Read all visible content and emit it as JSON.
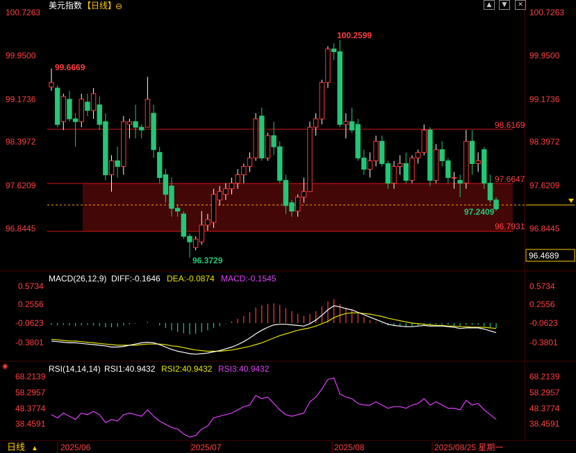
{
  "header": {
    "title": "美元指数",
    "period": "【日线】",
    "gear_icon": "⊖"
  },
  "colors": {
    "up": "#ff3b3b",
    "down": "#22c777",
    "diff": "#ffffff",
    "dea": "#e6e600",
    "macd": "#e040fb",
    "rsi": "#e040fb",
    "axis_text": "#ff4040",
    "grid": "#3a0000"
  },
  "price_axis": {
    "ticks": [
      "100.7263",
      "99.9500",
      "99.1736",
      "98.3972",
      "97.6209",
      "96.8445"
    ],
    "current": "96.4689"
  },
  "annotations": {
    "high": "100.2599",
    "start": "99.6669",
    "low": "96.3729",
    "last": "97.2409",
    "line_upper": "98.6169",
    "line_mid": "97.6647",
    "line_lower": "96.7931"
  },
  "macd": {
    "label": "MACD(26,12,9)",
    "diff_label": "DIFF:-0.1646",
    "dea_label": "DEA:-0.0874",
    "macd_label": "MACD:-0.1545",
    "ticks": [
      "0.5734",
      "0.2556",
      "-0.0623",
      "-0.3801"
    ]
  },
  "rsi": {
    "label": "RSI(14,14,14)",
    "rsi1_label": "RSI1:40.9432",
    "rsi2_label": "RSI2:40.9432",
    "rsi3_label": "RSI3:40.9432",
    "ticks": [
      "68.2139",
      "58.2957",
      "48.3774",
      "38.4591"
    ]
  },
  "footer": {
    "period_label": "日线",
    "dates": [
      "2025/06",
      "2025/07",
      "2025/08"
    ],
    "current_date": "2025/08/25 星期一"
  },
  "chart_data": {
    "type": "candlestick",
    "ylim": [
      96.1,
      100.8
    ],
    "candles": [
      {
        "o": 99.42,
        "h": 99.75,
        "l": 99.35,
        "c": 99.5
      },
      {
        "o": 99.4,
        "h": 99.45,
        "l": 98.7,
        "c": 98.75
      },
      {
        "o": 98.8,
        "h": 99.3,
        "l": 98.65,
        "c": 99.25
      },
      {
        "o": 99.2,
        "h": 99.35,
        "l": 98.8,
        "c": 98.85
      },
      {
        "o": 98.85,
        "h": 98.95,
        "l": 98.35,
        "c": 98.8
      },
      {
        "o": 98.8,
        "h": 99.3,
        "l": 98.7,
        "c": 99.2
      },
      {
        "o": 99.15,
        "h": 99.3,
        "l": 98.9,
        "c": 99.0
      },
      {
        "o": 99.0,
        "h": 99.4,
        "l": 98.85,
        "c": 99.3
      },
      {
        "o": 99.1,
        "h": 99.25,
        "l": 98.65,
        "c": 98.75
      },
      {
        "o": 98.8,
        "h": 98.95,
        "l": 97.75,
        "c": 97.85
      },
      {
        "o": 97.85,
        "h": 98.2,
        "l": 97.55,
        "c": 98.1
      },
      {
        "o": 98.1,
        "h": 98.35,
        "l": 97.8,
        "c": 98.0
      },
      {
        "o": 98.0,
        "h": 98.9,
        "l": 97.85,
        "c": 98.8
      },
      {
        "o": 98.75,
        "h": 98.85,
        "l": 98.5,
        "c": 98.8
      },
      {
        "o": 98.8,
        "h": 99.1,
        "l": 98.5,
        "c": 98.7
      },
      {
        "o": 98.7,
        "h": 98.75,
        "l": 98.5,
        "c": 98.65
      },
      {
        "o": 98.7,
        "h": 99.6,
        "l": 98.7,
        "c": 99.2
      },
      {
        "o": 98.95,
        "h": 99.1,
        "l": 98.15,
        "c": 98.3
      },
      {
        "o": 98.25,
        "h": 98.35,
        "l": 97.7,
        "c": 97.8
      },
      {
        "o": 97.85,
        "h": 97.95,
        "l": 97.35,
        "c": 97.5
      },
      {
        "o": 97.65,
        "h": 97.8,
        "l": 97.1,
        "c": 97.25
      },
      {
        "o": 97.25,
        "h": 97.3,
        "l": 97.1,
        "c": 97.2
      },
      {
        "o": 97.15,
        "h": 97.2,
        "l": 96.7,
        "c": 96.75
      },
      {
        "o": 96.75,
        "h": 96.8,
        "l": 96.37,
        "c": 96.65
      },
      {
        "o": 96.55,
        "h": 96.75,
        "l": 96.5,
        "c": 96.7
      },
      {
        "o": 96.65,
        "h": 97.2,
        "l": 96.6,
        "c": 96.95
      },
      {
        "o": 96.95,
        "h": 97.15,
        "l": 96.85,
        "c": 97.05
      },
      {
        "o": 97.0,
        "h": 97.6,
        "l": 96.9,
        "c": 97.5
      },
      {
        "o": 97.4,
        "h": 97.65,
        "l": 97.3,
        "c": 97.55
      },
      {
        "o": 97.5,
        "h": 97.7,
        "l": 97.4,
        "c": 97.6
      },
      {
        "o": 97.6,
        "h": 97.8,
        "l": 97.5,
        "c": 97.7
      },
      {
        "o": 97.7,
        "h": 97.95,
        "l": 97.6,
        "c": 97.85
      },
      {
        "o": 97.85,
        "h": 98.05,
        "l": 97.7,
        "c": 98.0
      },
      {
        "o": 98.0,
        "h": 98.25,
        "l": 97.9,
        "c": 98.15
      },
      {
        "o": 98.15,
        "h": 98.95,
        "l": 98.1,
        "c": 98.85
      },
      {
        "o": 98.9,
        "h": 99.05,
        "l": 98.1,
        "c": 98.15
      },
      {
        "o": 98.15,
        "h": 98.6,
        "l": 98.1,
        "c": 98.55
      },
      {
        "o": 98.55,
        "h": 98.8,
        "l": 98.2,
        "c": 98.35
      },
      {
        "o": 98.35,
        "h": 98.45,
        "l": 97.7,
        "c": 97.75
      },
      {
        "o": 97.75,
        "h": 97.85,
        "l": 97.15,
        "c": 97.3
      },
      {
        "o": 97.35,
        "h": 97.4,
        "l": 97.1,
        "c": 97.2
      },
      {
        "o": 97.2,
        "h": 97.5,
        "l": 97.1,
        "c": 97.45
      },
      {
        "o": 97.45,
        "h": 97.8,
        "l": 97.35,
        "c": 97.55
      },
      {
        "o": 97.55,
        "h": 98.8,
        "l": 97.55,
        "c": 98.7
      },
      {
        "o": 98.7,
        "h": 98.95,
        "l": 98.55,
        "c": 98.85
      },
      {
        "o": 98.85,
        "h": 99.55,
        "l": 98.75,
        "c": 99.5
      },
      {
        "o": 99.5,
        "h": 100.15,
        "l": 99.4,
        "c": 100.1
      },
      {
        "o": 100.1,
        "h": 100.2,
        "l": 99.9,
        "c": 100.05
      },
      {
        "o": 100.05,
        "h": 100.26,
        "l": 98.7,
        "c": 98.75
      },
      {
        "o": 98.75,
        "h": 98.95,
        "l": 98.5,
        "c": 98.8
      },
      {
        "o": 98.8,
        "h": 99.05,
        "l": 98.6,
        "c": 98.65
      },
      {
        "o": 98.75,
        "h": 98.85,
        "l": 98.1,
        "c": 98.15
      },
      {
        "o": 98.15,
        "h": 98.3,
        "l": 97.85,
        "c": 97.95
      },
      {
        "o": 97.95,
        "h": 98.25,
        "l": 97.8,
        "c": 98.1
      },
      {
        "o": 98.1,
        "h": 98.55,
        "l": 98.0,
        "c": 98.45
      },
      {
        "o": 98.45,
        "h": 98.55,
        "l": 98.0,
        "c": 98.05
      },
      {
        "o": 98.05,
        "h": 98.1,
        "l": 97.6,
        "c": 97.7
      },
      {
        "o": 97.7,
        "h": 98.1,
        "l": 97.6,
        "c": 98.0
      },
      {
        "o": 98.0,
        "h": 98.2,
        "l": 97.85,
        "c": 98.05
      },
      {
        "o": 98.05,
        "h": 98.25,
        "l": 97.7,
        "c": 97.75
      },
      {
        "o": 97.75,
        "h": 98.2,
        "l": 97.7,
        "c": 98.15
      },
      {
        "o": 98.15,
        "h": 98.3,
        "l": 98.05,
        "c": 98.25
      },
      {
        "o": 98.25,
        "h": 98.75,
        "l": 98.2,
        "c": 98.65
      },
      {
        "o": 98.65,
        "h": 98.7,
        "l": 97.65,
        "c": 97.75
      },
      {
        "o": 97.75,
        "h": 98.4,
        "l": 97.7,
        "c": 98.3
      },
      {
        "o": 98.3,
        "h": 98.45,
        "l": 98.0,
        "c": 98.1
      },
      {
        "o": 98.1,
        "h": 98.15,
        "l": 97.7,
        "c": 97.8
      },
      {
        "o": 97.8,
        "h": 97.9,
        "l": 97.6,
        "c": 97.8
      },
      {
        "o": 97.75,
        "h": 97.85,
        "l": 97.45,
        "c": 97.7
      },
      {
        "o": 97.7,
        "h": 98.65,
        "l": 97.6,
        "c": 98.45
      },
      {
        "o": 98.45,
        "h": 98.65,
        "l": 97.85,
        "c": 98.05
      },
      {
        "o": 98.05,
        "h": 98.25,
        "l": 97.9,
        "c": 98.1
      },
      {
        "o": 98.3,
        "h": 98.35,
        "l": 97.6,
        "c": 97.7
      },
      {
        "o": 97.7,
        "h": 97.85,
        "l": 97.35,
        "c": 97.4
      },
      {
        "o": 97.4,
        "h": 97.45,
        "l": 97.2,
        "c": 97.24
      }
    ],
    "macd_hist": [
      -0.03,
      -0.04,
      -0.03,
      -0.04,
      -0.05,
      -0.04,
      -0.03,
      -0.04,
      -0.05,
      -0.07,
      -0.07,
      -0.06,
      -0.04,
      -0.02,
      -0.01,
      0.0,
      0.02,
      0.0,
      -0.04,
      -0.08,
      -0.12,
      -0.15,
      -0.17,
      -0.19,
      -0.18,
      -0.15,
      -0.12,
      -0.08,
      -0.05,
      -0.01,
      0.03,
      0.07,
      0.12,
      0.18,
      0.26,
      0.3,
      0.32,
      0.33,
      0.3,
      0.25,
      0.2,
      0.15,
      0.12,
      0.15,
      0.2,
      0.28,
      0.36,
      0.4,
      0.32,
      0.26,
      0.22,
      0.16,
      0.1,
      0.05,
      0.02,
      -0.01,
      -0.04,
      -0.05,
      -0.05,
      -0.06,
      -0.05,
      -0.04,
      -0.02,
      -0.03,
      -0.02,
      -0.02,
      -0.03,
      -0.04,
      -0.05,
      -0.03,
      -0.03,
      -0.03,
      -0.05,
      -0.07,
      -0.08
    ],
    "macd_diff": [
      -0.3,
      -0.31,
      -0.32,
      -0.33,
      -0.33,
      -0.34,
      -0.35,
      -0.36,
      -0.37,
      -0.38,
      -0.4,
      -0.4,
      -0.39,
      -0.37,
      -0.35,
      -0.33,
      -0.32,
      -0.33,
      -0.36,
      -0.4,
      -0.44,
      -0.47,
      -0.49,
      -0.51,
      -0.52,
      -0.51,
      -0.5,
      -0.48,
      -0.46,
      -0.43,
      -0.4,
      -0.36,
      -0.31,
      -0.25,
      -0.18,
      -0.12,
      -0.07,
      -0.03,
      -0.02,
      -0.02,
      -0.03,
      -0.04,
      -0.05,
      -0.01,
      0.05,
      0.13,
      0.22,
      0.29,
      0.27,
      0.24,
      0.22,
      0.18,
      0.14,
      0.1,
      0.06,
      0.02,
      -0.02,
      -0.04,
      -0.05,
      -0.06,
      -0.06,
      -0.05,
      -0.04,
      -0.05,
      -0.05,
      -0.05,
      -0.06,
      -0.07,
      -0.09,
      -0.08,
      -0.08,
      -0.08,
      -0.1,
      -0.13,
      -0.16
    ],
    "macd_dea": [
      -0.27,
      -0.28,
      -0.29,
      -0.3,
      -0.3,
      -0.31,
      -0.32,
      -0.33,
      -0.34,
      -0.35,
      -0.36,
      -0.37,
      -0.37,
      -0.37,
      -0.37,
      -0.36,
      -0.35,
      -0.35,
      -0.35,
      -0.36,
      -0.38,
      -0.39,
      -0.41,
      -0.43,
      -0.45,
      -0.46,
      -0.47,
      -0.47,
      -0.47,
      -0.46,
      -0.45,
      -0.43,
      -0.41,
      -0.39,
      -0.36,
      -0.33,
      -0.29,
      -0.25,
      -0.21,
      -0.18,
      -0.15,
      -0.12,
      -0.1,
      -0.08,
      -0.05,
      -0.01,
      0.03,
      0.09,
      0.13,
      0.16,
      0.17,
      0.17,
      0.16,
      0.15,
      0.13,
      0.11,
      0.08,
      0.06,
      0.04,
      0.02,
      0.0,
      -0.01,
      -0.02,
      -0.03,
      -0.04,
      -0.04,
      -0.05,
      -0.05,
      -0.06,
      -0.06,
      -0.07,
      -0.07,
      -0.07,
      -0.08,
      -0.09
    ],
    "rsi": [
      44,
      42,
      45,
      43,
      41,
      45,
      44,
      46,
      44,
      39,
      41,
      40,
      44,
      45,
      44,
      43,
      47,
      43,
      40,
      38,
      36,
      35,
      32,
      30,
      31,
      35,
      37,
      42,
      43,
      44,
      45,
      47,
      49,
      50,
      56,
      54,
      55,
      51,
      47,
      44,
      43,
      44,
      45,
      52,
      55,
      60,
      66,
      67,
      57,
      55,
      54,
      51,
      50,
      50,
      52,
      50,
      48,
      49,
      49,
      48,
      50,
      51,
      54,
      50,
      52,
      50,
      48,
      48,
      47,
      53,
      50,
      51,
      47,
      44,
      41
    ]
  }
}
